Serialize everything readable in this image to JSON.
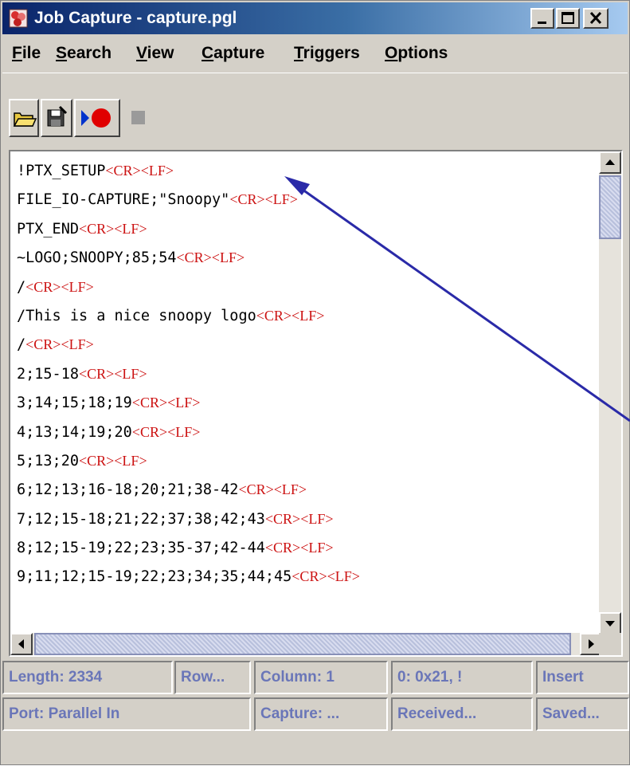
{
  "window": {
    "title": "Job Capture - capture.pgl"
  },
  "titlebar_buttons": [
    {
      "name": "minimize-button",
      "icon": "minimize-icon"
    },
    {
      "name": "maximize-button",
      "icon": "maximize-icon"
    },
    {
      "name": "close-button",
      "icon": "close-icon"
    }
  ],
  "menu": [
    {
      "mnemonic": "F",
      "rest": "ile"
    },
    {
      "mnemonic": "S",
      "rest": "earch"
    },
    {
      "mnemonic": "V",
      "rest": "iew"
    },
    {
      "mnemonic": "C",
      "rest": "apture"
    },
    {
      "mnemonic": "T",
      "rest": "riggers"
    },
    {
      "mnemonic": "O",
      "rest": "ptions"
    }
  ],
  "toolbar": [
    {
      "name": "open-button",
      "icon": "open-folder-icon"
    },
    {
      "name": "save-button",
      "icon": "save-disk-icon"
    },
    {
      "name": "start-capture-button",
      "icon": "play-record-icon"
    },
    {
      "name": "stop-capture-button",
      "icon": "stop-icon"
    }
  ],
  "editor": {
    "lines": [
      {
        "text": "!PTX_SETUP",
        "ctl": "<CR><LF>"
      },
      {
        "text": "FILE_IO-CAPTURE;\"Snoopy\"",
        "ctl": "<CR><LF>"
      },
      {
        "text": "PTX_END",
        "ctl": "<CR><LF>"
      },
      {
        "text": "~LOGO;SNOOPY;85;54",
        "ctl": "<CR><LF>"
      },
      {
        "text": "/",
        "ctl": "<CR><LF>"
      },
      {
        "text": "/This is a nice snoopy logo",
        "ctl": "<CR><LF>"
      },
      {
        "text": "/",
        "ctl": "<CR><LF>"
      },
      {
        "text": "2;15-18",
        "ctl": "<CR><LF>"
      },
      {
        "text": "3;14;15;18;19",
        "ctl": "<CR><LF>"
      },
      {
        "text": "4;13;14;19;20",
        "ctl": "<CR><LF>"
      },
      {
        "text": "5;13;20",
        "ctl": "<CR><LF>"
      },
      {
        "text": "6;12;13;16-18;20;21;38-42",
        "ctl": "<CR><LF>"
      },
      {
        "text": "7;12;15-18;21;22;37;38;42;43",
        "ctl": "<CR><LF>"
      },
      {
        "text": "8;12;15-19;22;23;35-37;42-44",
        "ctl": "<CR><LF>"
      },
      {
        "text": "9;11;12;15-19;22;23;34;35;44;45",
        "ctl": "<CR><LF>"
      }
    ]
  },
  "status": {
    "row1": [
      "Length: 2334",
      "Row...",
      "Column: 1",
      "0: 0x21, !",
      "Insert"
    ],
    "row2": [
      "Port: Parallel In",
      "Capture: ...",
      "Received...",
      "Saved..."
    ]
  },
  "colors": {
    "title_gradient_start": "#0a246a",
    "control_chars": "#cc1111",
    "status_text": "#6a76b8",
    "annotation_arrow": "#2a2aa8"
  }
}
